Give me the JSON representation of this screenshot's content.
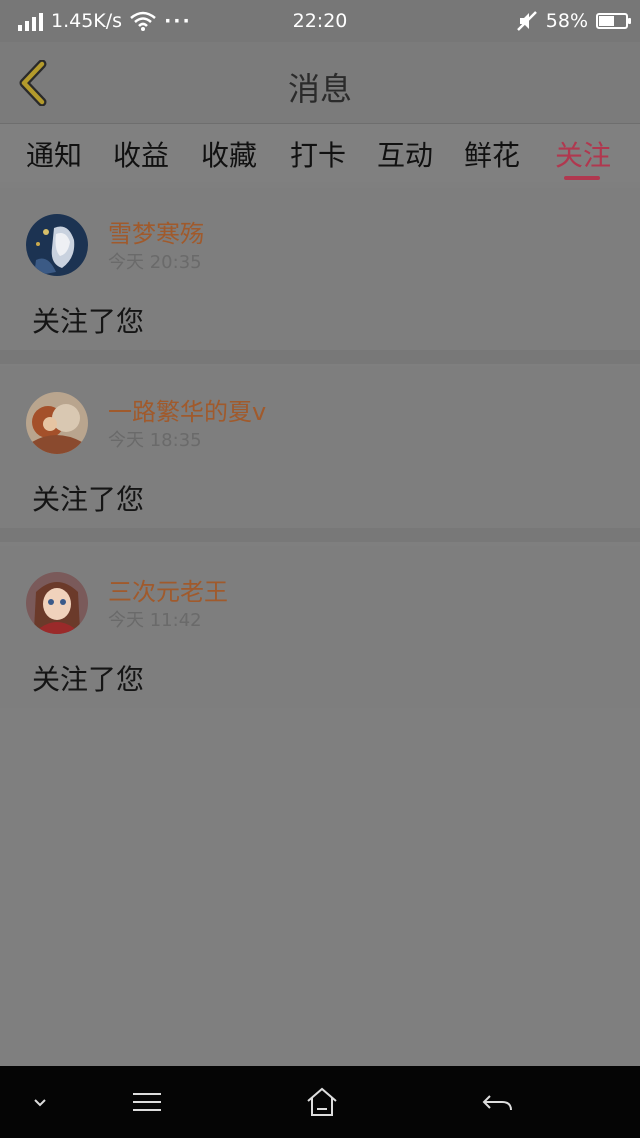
{
  "status": {
    "speed": "1.45K/s",
    "dots": "···",
    "time": "22:20",
    "battery": "58%",
    "battery_level": 0.58
  },
  "header": {
    "title": "消息"
  },
  "tabs": [
    {
      "label": "通知",
      "active": false
    },
    {
      "label": "收益",
      "active": false
    },
    {
      "label": "收藏",
      "active": false
    },
    {
      "label": "打卡",
      "active": false
    },
    {
      "label": "互动",
      "active": false
    },
    {
      "label": "鲜花",
      "active": false
    },
    {
      "label": "关注",
      "active": true
    }
  ],
  "messages": [
    {
      "user": "雪梦寒殇",
      "time": "今天 20:35",
      "text": "关注了您"
    },
    {
      "user": "一路繁华的夏v",
      "time": "今天 18:35",
      "text": "关注了您"
    },
    {
      "user": "三次元老王",
      "time": "今天 11:42",
      "text": "关注了您"
    }
  ],
  "colors": {
    "accent": "#b0384f",
    "username": "#a05a2c"
  }
}
